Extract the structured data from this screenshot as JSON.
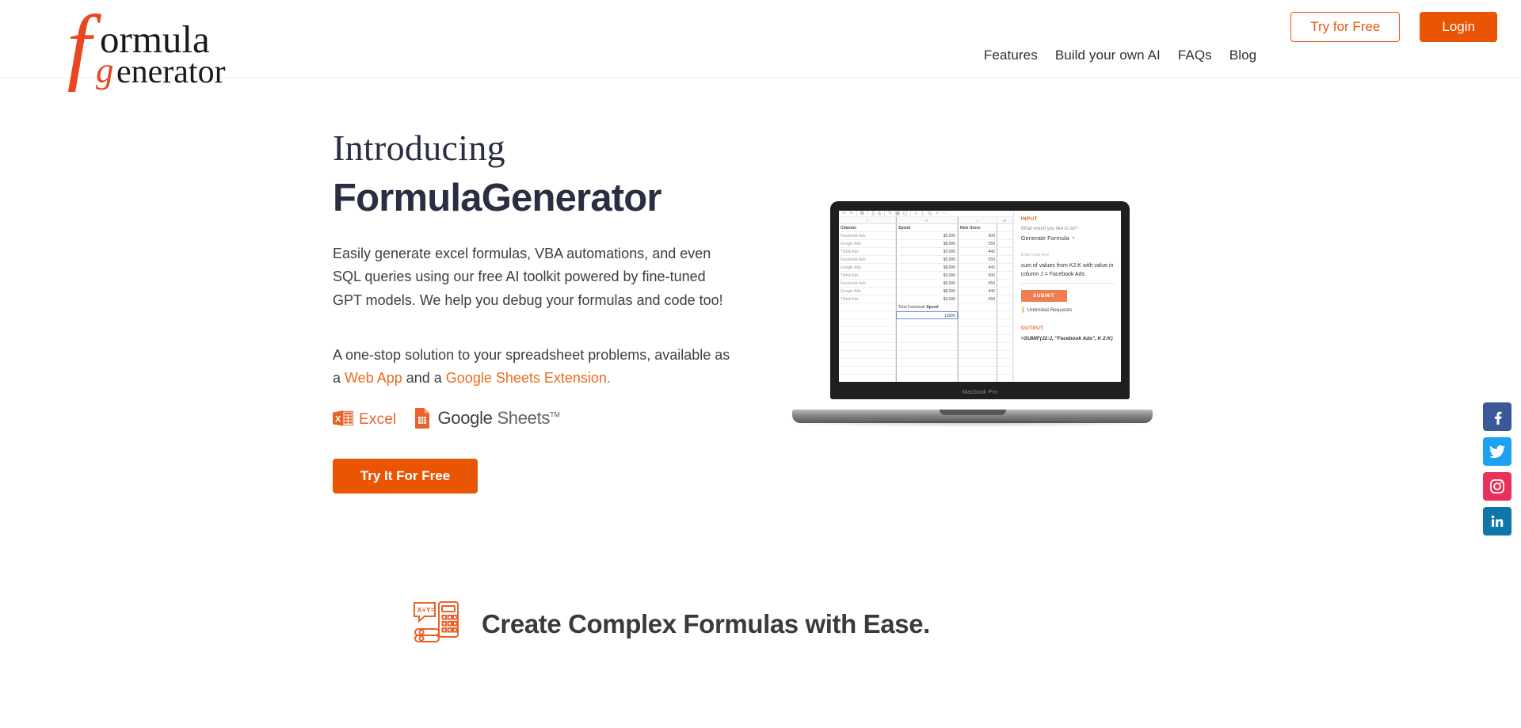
{
  "brand": {
    "logo_line1": "ormula",
    "logo_line2": "enerator",
    "logo_f": "f",
    "logo_g": "g",
    "accent": "#ea5504",
    "accent_alt": "#e8622a",
    "text_dark": "#2b2d42"
  },
  "nav": {
    "links": [
      {
        "label": "Features",
        "name": "nav-link-features"
      },
      {
        "label": "Build your own AI",
        "name": "nav-link-build-your-own-ai"
      },
      {
        "label": "FAQs",
        "name": "nav-link-faqs"
      },
      {
        "label": "Blog",
        "name": "nav-link-blog"
      }
    ],
    "try_for_free": "Try for Free",
    "login": "Login"
  },
  "hero": {
    "eyebrow": "Introducing",
    "headline": "FormulaGenerator",
    "lede": "Easily generate excel formulas, VBA automations, and even SQL queries using our free AI toolkit powered by fine-tuned GPT models. We help you debug your formulas and code too!",
    "subline_pre": "A one-stop solution to your spreadsheet problems, available as a ",
    "subline_link1": "Web App",
    "subline_mid": " and a ",
    "subline_link2": "Google Sheets Extension.",
    "excel_label": "Excel",
    "gsheets_google": "Google",
    "gsheets_sheets": "Sheets",
    "gsheets_tm": "TM",
    "cta": "Try It For Free"
  },
  "laptop": {
    "brand_label": "Macbook Pro",
    "sheet": {
      "col_letters": [
        "J",
        "K",
        "L",
        "M"
      ],
      "headers": [
        "Channel",
        "Spend",
        "New Users"
      ],
      "rows": [
        [
          "Facebook Ads",
          "$5,000",
          "500"
        ],
        [
          "Google Ads",
          "$8,000",
          "559"
        ],
        [
          "Tiktok Ads",
          "$3,000",
          "442"
        ],
        [
          "Facebook Ads",
          "$5,000",
          "559"
        ],
        [
          "Google Ads",
          "$8,000",
          "442"
        ],
        [
          "Tiktok Ads",
          "$3,000",
          "500"
        ],
        [
          "Facebook Ads",
          "$5,000",
          "559"
        ],
        [
          "Google Ads",
          "$8,000",
          "442"
        ],
        [
          "Tiktok Ads",
          "$3,000",
          "559"
        ]
      ],
      "total_label_pre": "Total Facebook ",
      "total_label_bold": "Spend",
      "total_value": "15000"
    },
    "ai": {
      "input_heading": "INPUT",
      "question": "What would you like to do?",
      "mode_value": "Generate Formula",
      "input_placeholder": "Enter input here",
      "input_value": "sum of values from K2:K with value in column J = Facebook Ads",
      "submit_label": "SUBMIT",
      "unlimited_label": "Unlimited Requests",
      "output_heading": "OUTPUT",
      "output_value": "=SUMIF(J2:J, \"Facebook Ads\", K 2:K)"
    }
  },
  "feature": {
    "icon_badge_text": "X+Y=",
    "title": "Create Complex Formulas with Ease."
  },
  "social": [
    {
      "name": "facebook",
      "label": "Facebook",
      "color": "#3b5998"
    },
    {
      "name": "twitter",
      "label": "Twitter",
      "color": "#1da1f2"
    },
    {
      "name": "instagram",
      "label": "Instagram",
      "color": "#e8315c"
    },
    {
      "name": "linkedin",
      "label": "LinkedIn",
      "color": "#0e76a8"
    }
  ]
}
